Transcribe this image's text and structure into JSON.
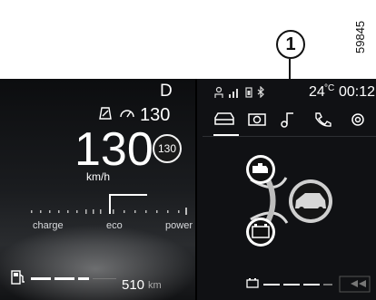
{
  "figure": {
    "figure_number": "59845",
    "callout_number": "1"
  },
  "cluster": {
    "gear": "D",
    "speed_limit": "130",
    "speed": "130",
    "speed_sign": "130",
    "speed_unit": "km/h",
    "gauge_labels": [
      "charge",
      "eco",
      "power"
    ],
    "range_value": "510",
    "range_unit": "km"
  },
  "status_bar": {
    "temperature": "24",
    "temperature_unit": "°C",
    "time": "00:12"
  },
  "tabs": [
    "car-icon",
    "camera-icon",
    "music-icon",
    "phone-icon",
    "settings-icon"
  ],
  "icons": {
    "engine_warning": "engine-warning-icon",
    "vehicle": "vehicle-icon",
    "battery": "battery-warning-icon"
  },
  "colors": {
    "background": "#0c0d0f",
    "text": "#ffffff",
    "active_tab": "#ffffff"
  }
}
